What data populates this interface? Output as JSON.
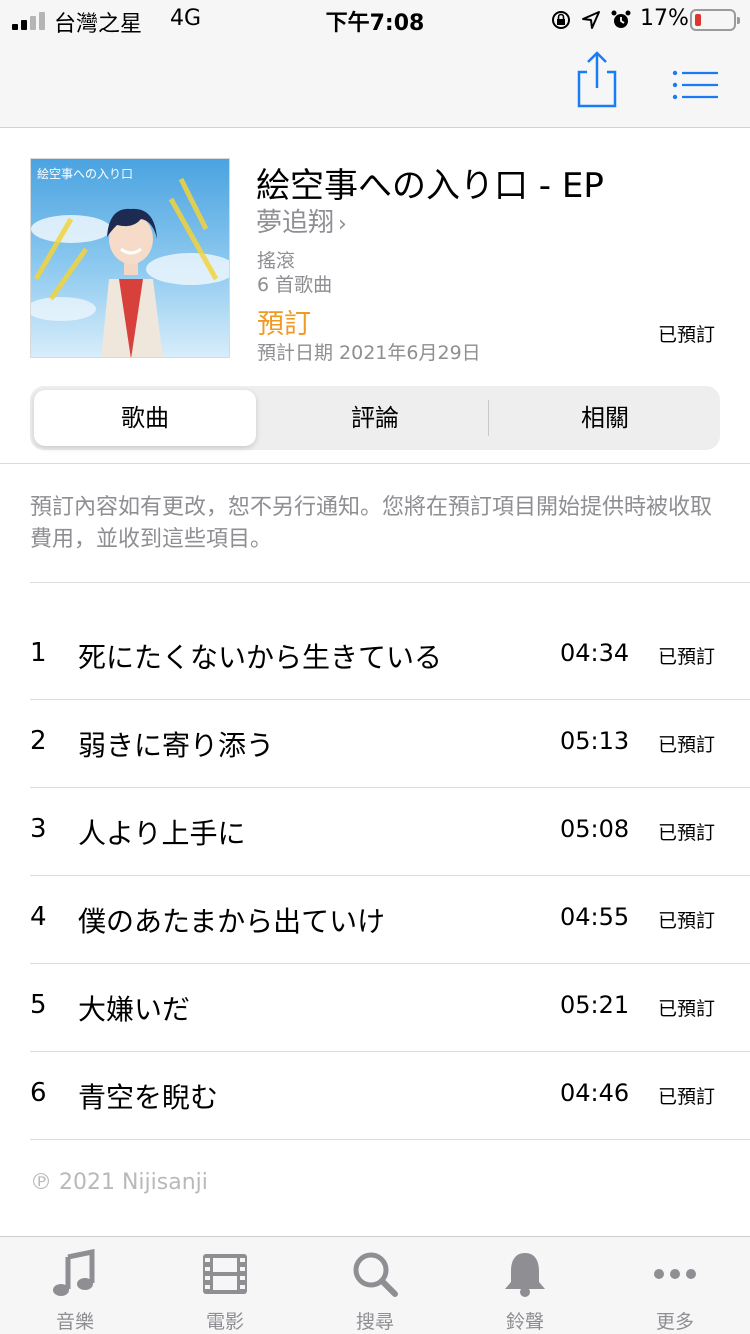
{
  "status_bar": {
    "carrier": "台灣之星",
    "network": "4G",
    "time": "下午7:08",
    "battery_percent": "17%",
    "battery_level": 0.17
  },
  "nav": {
    "share_icon": "share-icon",
    "list_icon": "list-icon"
  },
  "album": {
    "title": "絵空事への入り口 - EP",
    "artist": "夢追翔",
    "artist_chevron": "›",
    "genre": "搖滾",
    "track_count": "6 首歌曲",
    "preorder_label": "預訂",
    "release_date": "預計日期 2021年6月29日",
    "status": "已預訂",
    "cover_text": "絵空事への入り口"
  },
  "tabs": [
    {
      "label": "歌曲",
      "active": true
    },
    {
      "label": "評論",
      "active": false
    },
    {
      "label": "相關",
      "active": false
    }
  ],
  "notice": "預訂內容如有更改，恕不另行通知。您將在預訂項目開始提供時被收取費用，並收到這些項目。",
  "tracks": [
    {
      "number": "1",
      "title": "死にたくないから生きている",
      "duration": "04:34",
      "status": "已預訂"
    },
    {
      "number": "2",
      "title": "弱きに寄り添う",
      "duration": "05:13",
      "status": "已預訂"
    },
    {
      "number": "3",
      "title": "人より上手に",
      "duration": "05:08",
      "status": "已預訂"
    },
    {
      "number": "4",
      "title": "僕のあたまから出ていけ",
      "duration": "04:55",
      "status": "已預訂"
    },
    {
      "number": "5",
      "title": "大嫌いだ",
      "duration": "05:21",
      "status": "已預訂"
    },
    {
      "number": "6",
      "title": "青空を睨む",
      "duration": "04:46",
      "status": "已預訂"
    }
  ],
  "copyright": "℗ 2021 Nijisanji",
  "tab_bar": [
    {
      "label": "音樂",
      "icon": "music-note-icon"
    },
    {
      "label": "電影",
      "icon": "film-icon"
    },
    {
      "label": "搜尋",
      "icon": "search-icon"
    },
    {
      "label": "鈴聲",
      "icon": "bell-icon"
    },
    {
      "label": "更多",
      "icon": "more-icon"
    }
  ],
  "colors": {
    "accent_blue": "#1a7cf5",
    "preorder_orange": "#f09a23",
    "secondary_gray": "#8e8e93",
    "battery_red": "#e0342e"
  }
}
